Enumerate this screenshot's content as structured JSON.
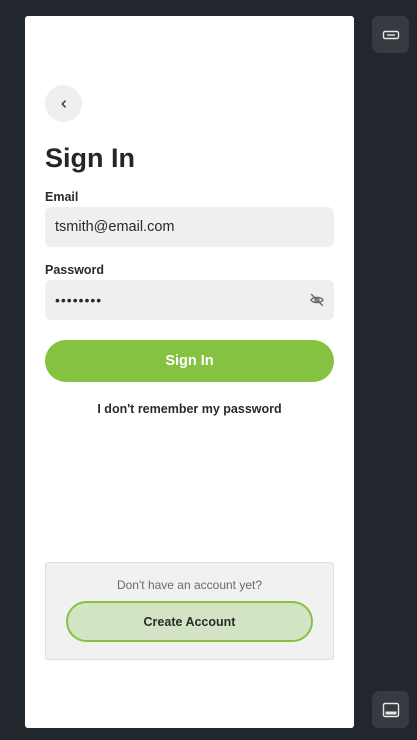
{
  "page": {
    "title": "Sign In"
  },
  "form": {
    "email_label": "Email",
    "email_value": "tsmith@email.com",
    "password_label": "Password",
    "password_value": "••••••••",
    "submit_label": "Sign In",
    "forgot_label": "I don't remember my password"
  },
  "signup": {
    "prompt": "Don't have an account yet?",
    "button_label": "Create Account"
  },
  "icons": {
    "back": "chevron-left-icon",
    "password_visibility": "eye-off-icon",
    "side_top": "keyboard-icon",
    "side_bottom": "panel-bottom-icon"
  },
  "colors": {
    "background": "#21272c",
    "accent": "#86c242",
    "accent_soft": "#d3e4c5",
    "field_bg": "#efefef"
  }
}
